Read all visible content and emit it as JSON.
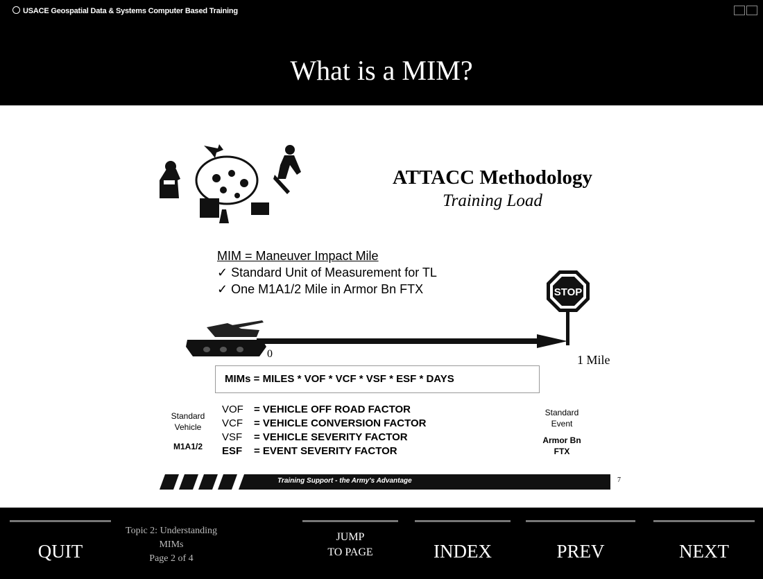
{
  "window": {
    "title": "USACE Geospatial Data & Systems Computer Based Training"
  },
  "page_title": "What is a MIM?",
  "slide": {
    "heading": "ATTACC Methodology",
    "subheading": "Training Load",
    "mim_definition": "MIM = Maneuver Impact Mile",
    "bullets": [
      "✓ Standard Unit of Measurement for TL",
      "✓ One M1A1/2 Mile in Armor Bn FTX"
    ],
    "stop_sign": "STOP",
    "scale_start": "0",
    "scale_end": "1 Mile",
    "formula": "MIMs = MILES * VOF * VCF * VSF * ESF * DAYS",
    "standard_vehicle": {
      "label_line1": "Standard",
      "label_line2": "Vehicle",
      "value": "M1A1/2"
    },
    "factors": [
      {
        "abbr": "VOF",
        "desc": "= VEHICLE OFF ROAD FACTOR"
      },
      {
        "abbr": "VCF",
        "desc": "= VEHICLE CONVERSION FACTOR"
      },
      {
        "abbr": "VSF",
        "desc": "= VEHICLE SEVERITY FACTOR"
      },
      {
        "abbr": "ESF",
        "desc": "= EVENT SEVERITY FACTOR"
      }
    ],
    "standard_event": {
      "label_line1": "Standard",
      "label_line2": "Event",
      "value_line1": "Armor Bn",
      "value_line2": "FTX"
    },
    "footer": "Training Support - the Army's Advantage",
    "slide_number": "7"
  },
  "nav": {
    "quit": "QUIT",
    "topic_line1": "Topic 2: Understanding MIMs",
    "topic_line2": "Page 2 of 4",
    "jump_line1": "JUMP",
    "jump_line2": "TO PAGE",
    "index": "INDEX",
    "prev": "PREV",
    "next": "NEXT"
  },
  "colors": {
    "background": "#000000",
    "slide": "#ffffff",
    "text_light": "#ffffff"
  }
}
